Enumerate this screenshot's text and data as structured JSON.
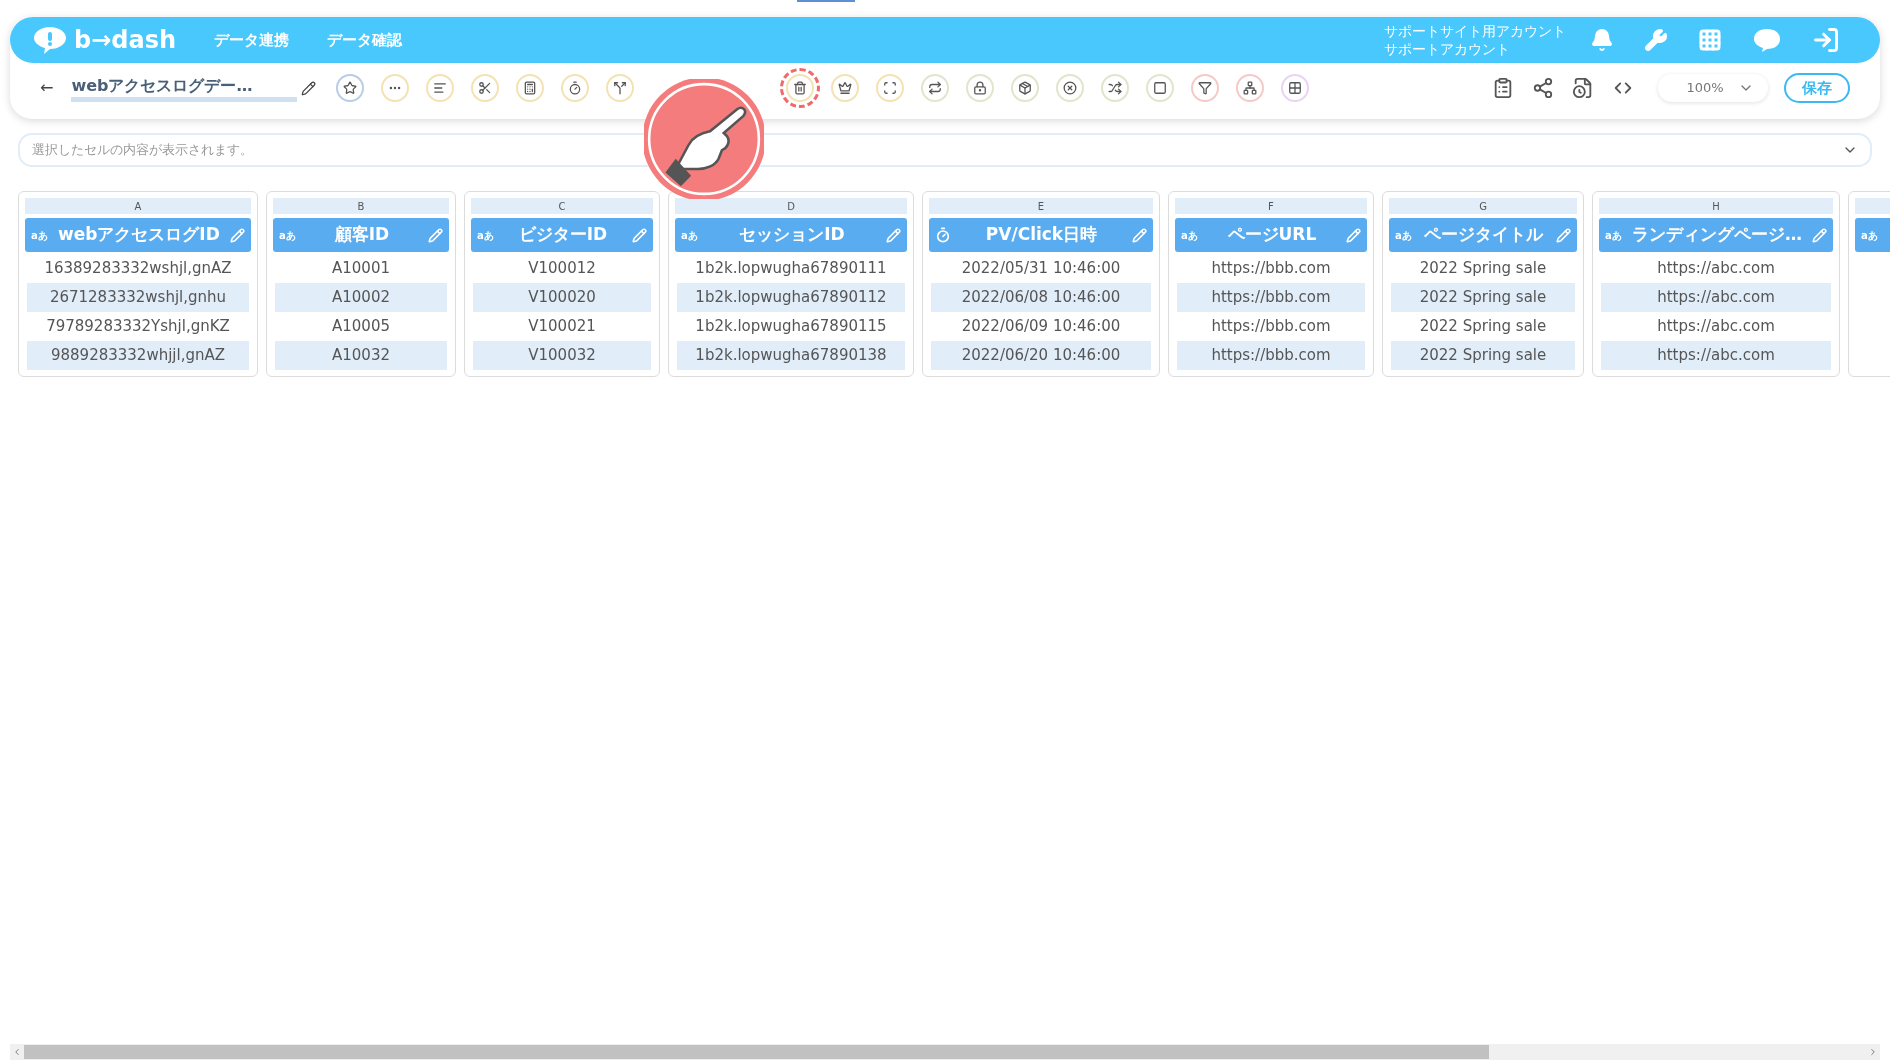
{
  "header": {
    "logo": "b→dash",
    "nav": [
      "データ連携",
      "データ確認"
    ],
    "account": [
      "サポートサイト用アカウント",
      "サポートアカウント"
    ]
  },
  "toolbar": {
    "back": "←",
    "title": "webアクセスログデー…",
    "zoom": "100%",
    "save": "保存",
    "tools": [
      {
        "kind": "star",
        "color": "#b9cde6",
        "highlighted": false
      },
      {
        "kind": "dots",
        "color": "#f3e2b3",
        "highlighted": false
      },
      {
        "kind": "lines",
        "color": "#f3e2b3",
        "highlighted": false
      },
      {
        "kind": "scissors",
        "color": "#f3e2b3",
        "highlighted": false
      },
      {
        "kind": "calc",
        "color": "#f3e2b3",
        "highlighted": false
      },
      {
        "kind": "timer",
        "color": "#f3e2b3",
        "highlighted": false
      },
      {
        "kind": "split",
        "color": "#f3e2b3",
        "highlighted": false
      },
      {
        "kind": "trash",
        "color": "#f3e2b3",
        "highlighted": true
      },
      {
        "kind": "crown",
        "color": "#f3e2b3",
        "highlighted": false
      },
      {
        "kind": "expand",
        "color": "#f3e2b3",
        "highlighted": false
      },
      {
        "kind": "repeat",
        "color": "#dfe6cc",
        "highlighted": false
      },
      {
        "kind": "lock",
        "color": "#dfe6cc",
        "highlighted": false
      },
      {
        "kind": "box",
        "color": "#dfe6cc",
        "highlighted": false
      },
      {
        "kind": "xcircle",
        "color": "#dfe6cc",
        "highlighted": false
      },
      {
        "kind": "shuffle",
        "color": "#dfe6cc",
        "highlighted": false
      },
      {
        "kind": "square",
        "color": "#dfe6cc",
        "highlighted": false
      },
      {
        "kind": "filter",
        "color": "#f6c9c9",
        "highlighted": false
      },
      {
        "kind": "tree",
        "color": "#f6c9c9",
        "highlighted": false
      },
      {
        "kind": "grid",
        "color": "#ecd2f3",
        "highlighted": false
      }
    ]
  },
  "formula_bar": {
    "placeholder": "選択したセルの内容が表示されます。"
  },
  "columns": [
    {
      "letter": "A",
      "kind": "text",
      "type_label": "aあ",
      "title": "webアクセスログID",
      "cells": [
        "16389283332wshjl,gnAZ",
        "2671283332wshjl,gnhu",
        "79789283332Yshjl,gnKZ",
        "9889283332whjjl,gnAZ"
      ]
    },
    {
      "letter": "B",
      "kind": "text",
      "type_label": "aあ",
      "title": "顧客ID",
      "cells": [
        "A10001",
        "A10002",
        "A10005",
        "A10032"
      ]
    },
    {
      "letter": "C",
      "kind": "text",
      "type_label": "aあ",
      "title": "ビジターID",
      "cells": [
        "V100012",
        "V100020",
        "V100021",
        "V100032"
      ]
    },
    {
      "letter": "D",
      "kind": "text",
      "type_label": "aあ",
      "title": "セッションID",
      "cells": [
        "1b2k.lopwugha67890111",
        "1b2k.lopwugha67890112",
        "1b2k.lopwugha67890115",
        "1b2k.lopwugha67890138"
      ]
    },
    {
      "letter": "E",
      "kind": "datetime",
      "title": "PV/Click日時",
      "cells": [
        "2022/05/31 10:46:00",
        "2022/06/08 10:46:00",
        "2022/06/09 10:46:00",
        "2022/06/20 10:46:00"
      ]
    },
    {
      "letter": "F",
      "kind": "text",
      "type_label": "aあ",
      "title": "ページURL",
      "cells": [
        "https://bbb.com",
        "https://bbb.com",
        "https://bbb.com",
        "https://bbb.com"
      ]
    },
    {
      "letter": "G",
      "kind": "text",
      "type_label": "aあ",
      "title": "ページタイトル",
      "cells": [
        "2022 Spring sale",
        "2022 Spring sale",
        "2022 Spring sale",
        "2022 Spring sale"
      ]
    },
    {
      "letter": "H",
      "kind": "text",
      "type_label": "aあ",
      "title": "ランディングページ…",
      "cells": [
        "https://abc.com",
        "https://abc.com",
        "https://abc.com",
        "https://abc.com"
      ]
    }
  ],
  "partial_column": {
    "type_label": "aあ"
  }
}
